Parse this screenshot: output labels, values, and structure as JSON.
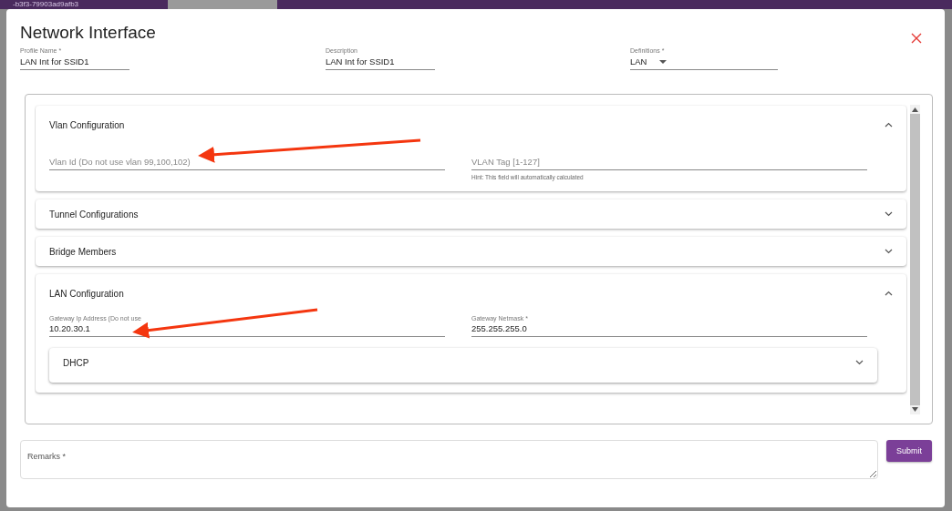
{
  "backdrop": {
    "text": "-b3f3-79903ad9afb3"
  },
  "dialog": {
    "title": "Network Interface",
    "fields": [
      {
        "kind": "text",
        "label": "Profile Name *",
        "value": "LAN Int for SSID1"
      },
      {
        "kind": "text",
        "label": "Description",
        "value": "LAN Int for SSID1"
      },
      {
        "kind": "select",
        "label": "Definitions *",
        "value": "LAN"
      }
    ],
    "sections": [
      {
        "title": "Vlan Configuration",
        "expanded": true,
        "fields": [
          {
            "placeholder": "Vlan Id (Do not use vlan 99,100,102)"
          },
          {
            "placeholder": "VLAN Tag [1-127]",
            "hint": "Hint: This field will automatically calculated"
          }
        ]
      },
      {
        "title": "Tunnel Configurations",
        "expanded": false
      },
      {
        "title": "Bridge Members",
        "expanded": false
      },
      {
        "title": "LAN Configuration",
        "expanded": true,
        "fields": [
          {
            "label": "Gateway Ip Address (Do not use",
            "value": "10.20.30.1"
          },
          {
            "label": "Gateway Netmask *",
            "value": "255.255.255.0"
          }
        ],
        "subsections": [
          {
            "title": "DHCP",
            "expanded": false
          }
        ]
      }
    ],
    "remarks": {
      "placeholder": "Remarks *"
    },
    "submit": "Submit"
  }
}
